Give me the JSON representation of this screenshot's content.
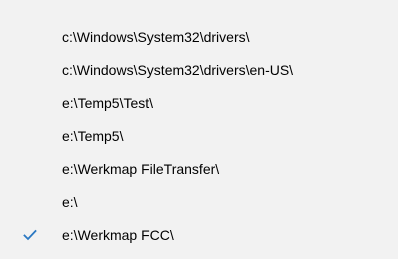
{
  "menu": {
    "items": [
      {
        "label": "c:\\Windows\\System32\\drivers\\",
        "checked": false
      },
      {
        "label": "c:\\Windows\\System32\\drivers\\en-US\\",
        "checked": false
      },
      {
        "label": "e:\\Temp5\\Test\\",
        "checked": false
      },
      {
        "label": "e:\\Temp5\\",
        "checked": false
      },
      {
        "label": "e:\\Werkmap FileTransfer\\",
        "checked": false
      },
      {
        "label": "e:\\",
        "checked": false
      },
      {
        "label": "e:\\Werkmap FCC\\",
        "checked": true
      }
    ],
    "check_icon": "checkmark-icon",
    "check_color": "#2b78c2",
    "background": "#f2f2f2"
  }
}
